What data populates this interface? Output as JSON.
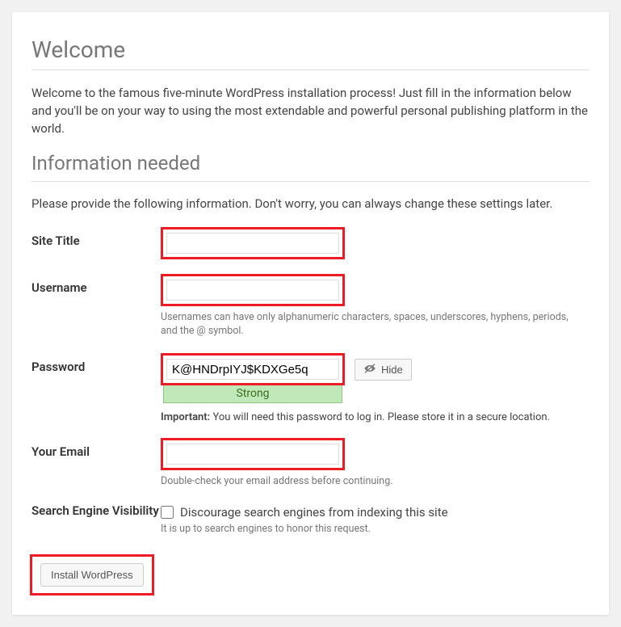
{
  "heading_welcome": "Welcome",
  "intro_text": "Welcome to the famous five-minute WordPress installation process! Just fill in the information below and you'll be on your way to using the most extendable and powerful personal publishing platform in the world.",
  "heading_info": "Information needed",
  "subintro_text": "Please provide the following information. Don't worry, you can always change these settings later.",
  "labels": {
    "site_title": "Site Title",
    "username": "Username",
    "password": "Password",
    "your_email": "Your Email",
    "search_visibility": "Search Engine Visibility"
  },
  "values": {
    "site_title": "",
    "username": "",
    "password": "K@HNDrpIYJ$KDXGe5q",
    "your_email": ""
  },
  "hints": {
    "username": "Usernames can have only alphanumeric characters, spaces, underscores, hyphens, periods, and the @ symbol.",
    "email": "Double-check your email address before continuing.",
    "search": "It is up to search engines to honor this request."
  },
  "password_strength": "Strong",
  "password_important_label": "Important:",
  "password_important_text": " You will need this password to log in. Please store it in a secure location.",
  "hide_button": "Hide",
  "discourage_label": "Discourage search engines from indexing this site",
  "install_button": "Install WordPress"
}
